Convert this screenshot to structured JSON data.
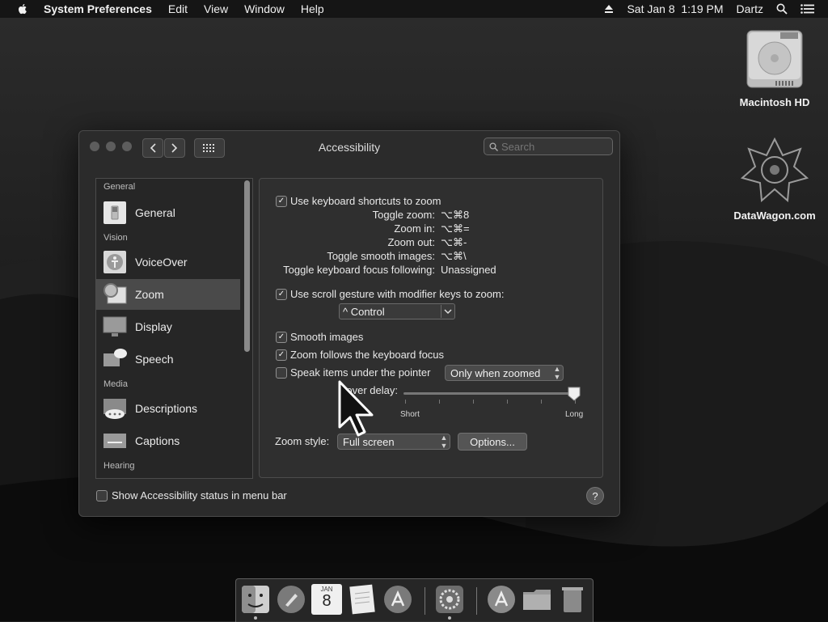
{
  "menubar": {
    "app_name": "System Preferences",
    "menus": [
      "Edit",
      "View",
      "Window",
      "Help"
    ],
    "datetime": "Sat Jan 8  1:19 PM",
    "user": "Dartz",
    "icons": [
      "apple-icon",
      "eject-icon",
      "spotlight-search-icon",
      "notification-center-icon"
    ]
  },
  "desktop": {
    "icons": [
      {
        "label": "Macintosh HD"
      },
      {
        "label": "DataWagon.com"
      }
    ]
  },
  "window": {
    "title": "Accessibility",
    "search_placeholder": "Search"
  },
  "sidebar": {
    "sections": {
      "general": "General",
      "vision": "Vision",
      "media": "Media",
      "hearing": "Hearing"
    },
    "items": [
      {
        "label": "General"
      },
      {
        "label": "VoiceOver"
      },
      {
        "label": "Zoom"
      },
      {
        "label": "Display"
      },
      {
        "label": "Speech"
      },
      {
        "label": "Descriptions"
      },
      {
        "label": "Captions"
      }
    ],
    "selected": "Zoom"
  },
  "zoom": {
    "keyboard_shortcuts": {
      "label": "Use keyboard shortcuts to zoom",
      "checked": true
    },
    "shortcuts": [
      {
        "key": "Toggle zoom:",
        "value": "⌥⌘8"
      },
      {
        "key": "Zoom in:",
        "value": "⌥⌘="
      },
      {
        "key": "Zoom out:",
        "value": "⌥⌘-"
      },
      {
        "key": "Toggle smooth images:",
        "value": "⌥⌘\\"
      },
      {
        "key": "Toggle keyboard focus following:",
        "value": "Unassigned"
      }
    ],
    "scroll_gesture": {
      "label": "Use scroll gesture with modifier keys to zoom:",
      "checked": true
    },
    "modifier_key": "^ Control",
    "smooth_images": {
      "label": "Smooth images",
      "checked": true
    },
    "follow_focus": {
      "label": "Zoom follows the keyboard focus",
      "checked": true
    },
    "speak_items": {
      "label": "Speak items under the pointer",
      "checked": false
    },
    "speak_mode": "Only when zoomed",
    "hover_delay": {
      "label": "Hover delay:",
      "min_label": "Short",
      "max_label": "Long",
      "value": 1.0
    },
    "zoom_style_label": "Zoom style:",
    "zoom_style_value": "Full screen",
    "options_button": "Options..."
  },
  "footer": {
    "status_checkbox": {
      "label": "Show Accessibility status in menu bar",
      "checked": false
    },
    "help": "?"
  },
  "dock": {
    "calendar_day": "8",
    "calendar_month": "JAN",
    "items": [
      "finder-icon",
      "launchpad-icon",
      "calendar-icon",
      "notes-icon",
      "app-store-icon",
      "system-preferences-icon",
      "applications-folder-icon",
      "documents-folder-icon",
      "trash-icon"
    ]
  },
  "colors": {
    "window_bg": "#2b2b2b",
    "selected_row": "#4a4a4a",
    "text": "#e8e8e8"
  }
}
